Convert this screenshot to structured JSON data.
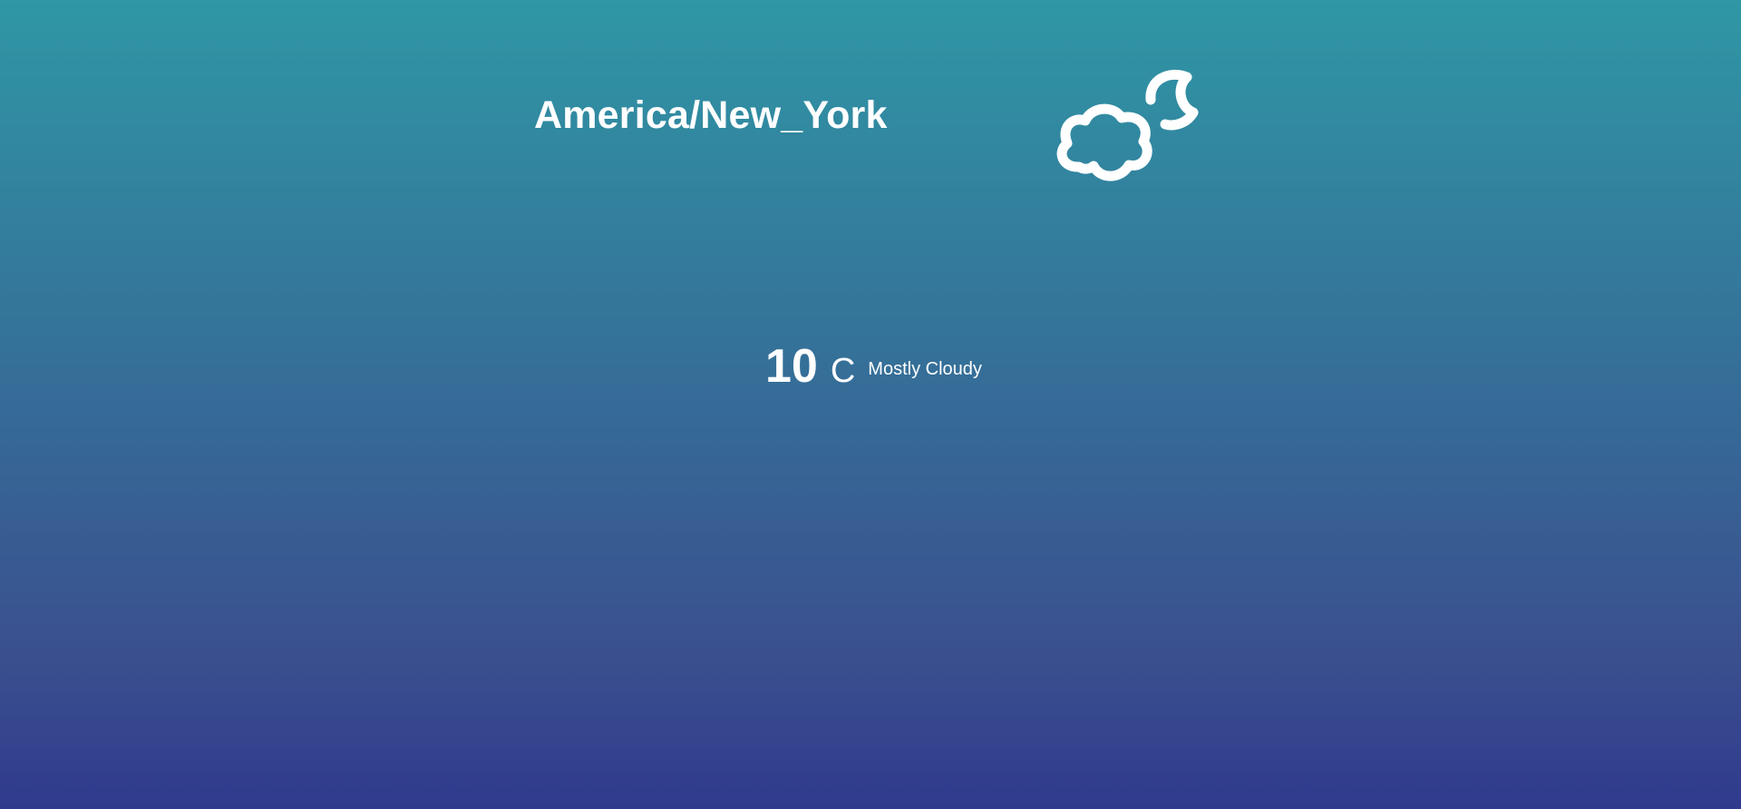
{
  "location": {
    "timezone": "America/New_York"
  },
  "weather": {
    "icon": "partly-cloudy-night-icon",
    "temperature": "10",
    "unit": "C",
    "summary": "Mostly Cloudy"
  },
  "colors": {
    "background_top": "#2f97a5",
    "background_bottom": "#2f3a8d",
    "text": "#ffffff"
  }
}
